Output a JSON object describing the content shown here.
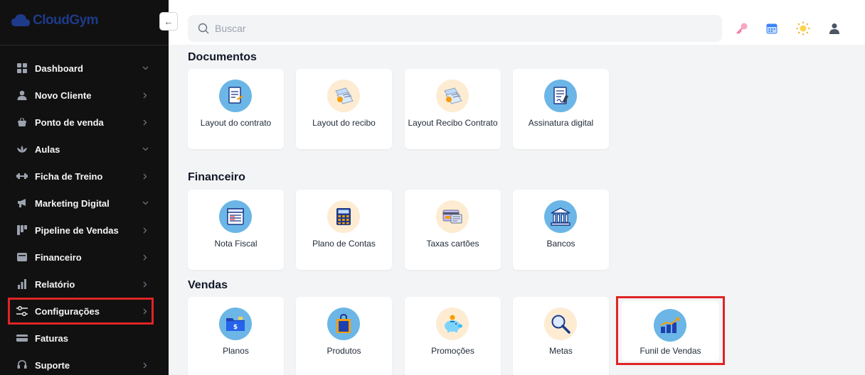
{
  "app": {
    "logo_text": "CloudGym",
    "brand_color": "#1e3a8a",
    "highlight_color": "#e02424"
  },
  "sidebar": {
    "items": [
      {
        "label": "Dashboard",
        "icon": "grid-icon",
        "chevron": "down"
      },
      {
        "label": "Novo Cliente",
        "icon": "user-icon",
        "chevron": "right"
      },
      {
        "label": "Ponto de venda",
        "icon": "basket-icon",
        "chevron": "right"
      },
      {
        "label": "Aulas",
        "icon": "lotus-icon",
        "chevron": "down"
      },
      {
        "label": "Ficha de Treino",
        "icon": "dumbbell-icon",
        "chevron": "right"
      },
      {
        "label": "Marketing Digital",
        "icon": "megaphone-icon",
        "chevron": "down"
      },
      {
        "label": "Pipeline de Vendas",
        "icon": "pipeline-icon",
        "chevron": "right"
      },
      {
        "label": "Financeiro",
        "icon": "wallet-icon",
        "chevron": "right"
      },
      {
        "label": "Relatório",
        "icon": "bar-chart-icon",
        "chevron": "right"
      },
      {
        "label": "Configurações",
        "icon": "sliders-icon",
        "chevron": "right"
      },
      {
        "label": "Faturas",
        "icon": "credit-card-icon",
        "chevron": ""
      },
      {
        "label": "Suporte",
        "icon": "support-icon",
        "chevron": "right"
      }
    ]
  },
  "header": {
    "search_placeholder": "Buscar",
    "collapse_label": "←",
    "icons": [
      "key-icon",
      "calendar-icon",
      "sun-icon",
      "user-profile-icon"
    ]
  },
  "sections": [
    {
      "title": "Documentos",
      "cards": [
        {
          "label": "Layout do contrato",
          "icon": "contract-icon",
          "bg": "#6bb6e6"
        },
        {
          "label": "Layout do recibo",
          "icon": "receipt-icon",
          "bg": "#fdecd2"
        },
        {
          "label": "Layout Recibo Contrato",
          "icon": "receipt-contract-icon",
          "bg": "#fdecd2"
        },
        {
          "label": "Assinatura digital",
          "icon": "digital-signature-icon",
          "bg": "#6bb6e6"
        }
      ]
    },
    {
      "title": "Financeiro",
      "cards": [
        {
          "label": "Nota Fiscal",
          "icon": "invoice-icon",
          "bg": "#6bb6e6"
        },
        {
          "label": "Plano de Contas",
          "icon": "calculator-icon",
          "bg": "#fdecd2"
        },
        {
          "label": "Taxas cartões",
          "icon": "card-fees-icon",
          "bg": "#fdecd2"
        },
        {
          "label": "Bancos",
          "icon": "bank-icon",
          "bg": "#6bb6e6"
        }
      ]
    },
    {
      "title": "Vendas",
      "cards": [
        {
          "label": "Planos",
          "icon": "plans-folder-icon",
          "bg": "#6bb6e6"
        },
        {
          "label": "Produtos",
          "icon": "shopping-bag-icon",
          "bg": "#6bb6e6"
        },
        {
          "label": "Promoções",
          "icon": "piggy-bank-icon",
          "bg": "#fdecd2"
        },
        {
          "label": "Metas",
          "icon": "magnifier-icon",
          "bg": "#fdecd2"
        },
        {
          "label": "Funil de Vendas",
          "icon": "sales-funnel-chart-icon",
          "bg": "#6bb6e6"
        }
      ]
    }
  ]
}
